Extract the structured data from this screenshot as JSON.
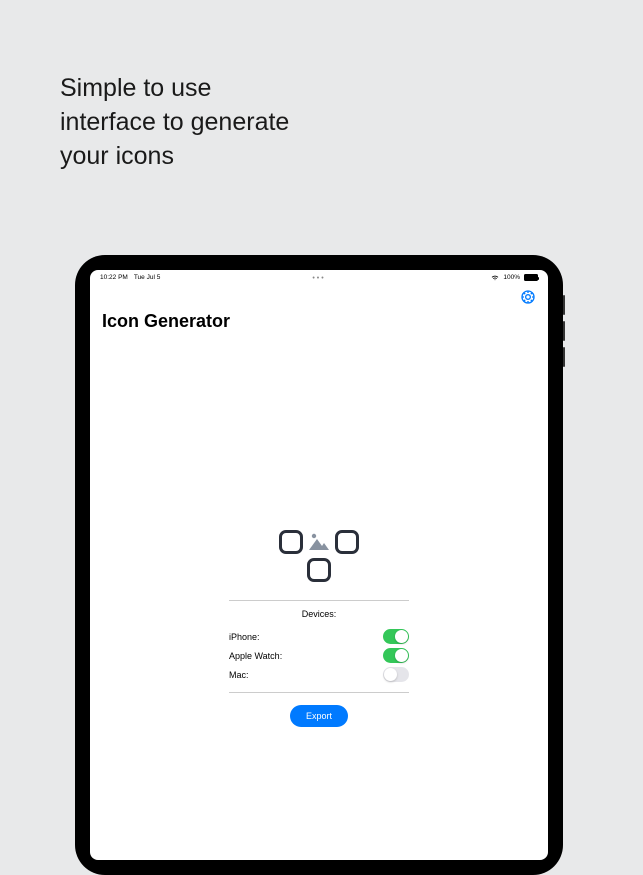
{
  "marketing": {
    "headline_line1": "Simple to use",
    "headline_line2": "interface to generate",
    "headline_line3": "your icons"
  },
  "status_bar": {
    "time": "10:22 PM",
    "date": "Tue Jul 5",
    "battery_percent": "100%"
  },
  "app": {
    "title": "Icon Generator",
    "devices_section_label": "Devices:",
    "devices": [
      {
        "label": "iPhone:",
        "enabled": true
      },
      {
        "label": "Apple Watch:",
        "enabled": true
      },
      {
        "label": "Mac:",
        "enabled": false
      }
    ],
    "export_label": "Export"
  }
}
